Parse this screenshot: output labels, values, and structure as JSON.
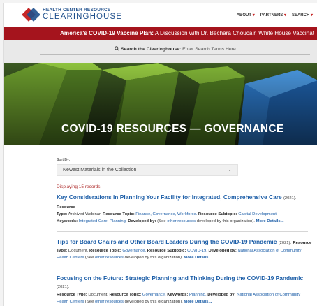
{
  "logo": {
    "line1": "HEALTH CENTER RESOURCE",
    "line2": "CLEARINGHOUSE"
  },
  "nav": [
    {
      "label": "ABOUT",
      "dropdown": "▾"
    },
    {
      "label": "PARTNERS",
      "dropdown": "▾"
    },
    {
      "label": "SEARCH",
      "dropdown": "▾"
    }
  ],
  "banner": {
    "bold": "America's COVID-19 Vaccine Plan:",
    "rest": " A Discussion with Dr. Bechara Choucair, White House Vaccinat"
  },
  "search": {
    "icon": "search-icon",
    "bold": "Search the Clearinghouse:",
    "placeholder": " Enter Search Terms Here"
  },
  "hero": {
    "title": "COVID-19 RESOURCES — GOVERNANCE"
  },
  "sort": {
    "label": "Sort By:",
    "selected": "Newest Materials in the Collection",
    "chevron": "⌄"
  },
  "displaying": "Displaying 15 records",
  "records": [
    {
      "title": "Key Considerations in Planning Your Facility for Integrated, Comprehensive Care",
      "year": "(2021).",
      "line1_label_resource": "Resource",
      "type_label": "Type:",
      "type_value": "Archived Webinar.",
      "topic_label": "Resource Topic:",
      "topic_value": "Finance, Governance, Workforce.",
      "subtopic_label": "Resource Subtopic:",
      "subtopic_value": "Capital Development.",
      "keywords_label": "Keywords:",
      "keywords_value": "Integrated Care, Planning.",
      "dev_label": "Developed by:",
      "dev_prefix": "(See ",
      "dev_link": "other resources",
      "dev_suffix": " developed by this organization).",
      "more": "More Details..."
    },
    {
      "title": "Tips for Board Chairs and Other Board Leaders During the COVID-19 Pandemic",
      "year": "(2021).",
      "line1_label_resource": "Resource",
      "type_label": "Type:",
      "type_value": "Document.",
      "topic_label": "Resource Topic:",
      "topic_value": "Governance.",
      "subtopic_label": "Resource Subtopic:",
      "subtopic_value": "COVID-19.",
      "dev_label": "Developed by:",
      "dev_org": "National Association of Community Health Centers",
      "dev_prefix": " (See ",
      "dev_link": "other resources",
      "dev_suffix": " developed by this organization).",
      "more": "More Details..."
    },
    {
      "title": "Focusing on the Future: Strategic Planning and Thinking During the COVID-19 Pandemic",
      "year": "(2021).",
      "type_label": "Resource Type:",
      "type_value": "Document.",
      "topic_label": "Resource Topic:",
      "topic_value": "Governance.",
      "keywords_label": "Keywords:",
      "keywords_value": "Planning.",
      "dev_label": "Developed by:",
      "dev_org": "National Association of Community Health Centers",
      "dev_prefix": " (See ",
      "dev_link": "other resources",
      "dev_suffix": " developed by this organization).",
      "more": "More Details..."
    }
  ]
}
